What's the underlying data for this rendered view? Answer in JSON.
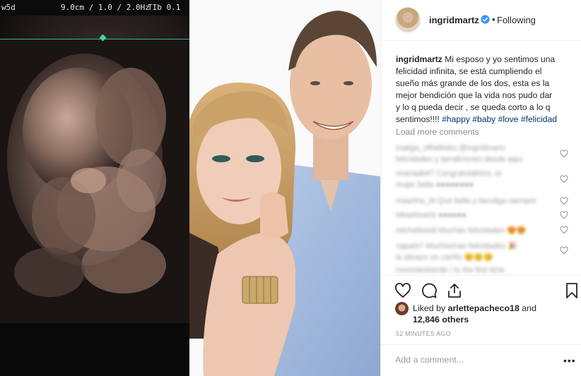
{
  "ultrasound": {
    "label_left": "w5d",
    "label_depth": "9.0cm / 1.0 / 2.0Hz",
    "label_tib": "TIb  0.1"
  },
  "header": {
    "username": "ingridmartz",
    "separator": "•",
    "follow_label": "Following"
  },
  "caption": {
    "username": "ingridmartz",
    "line1": " Mi esposo y yo sentimos una",
    "line2": "felicidad infinita, se está cumpliendo el",
    "line3": "sueño más grande de los dos, esta es la",
    "line4": "mejor bendición que la vida nos pudo dar",
    "line5": "y lo q pueda decir , se queda corto a lo q",
    "line6": "sentimos!!!! ",
    "hashtags": [
      "#happy",
      "#baby",
      "#love",
      "#felicidad"
    ]
  },
  "load_more": "Load more comments",
  "comments": [
    "matiga_ofhelitabx @ingridmartz",
    "felicidades y bendiciones desde aqui",
    "veanaab47 Congratulations, la",
    "mujer bella ●●●●●●●●",
    "maartha_9t Qué bella y bendiga siempre",
    "lekaahearts ●●●●●●",
    "michellesolt Muchas felicidades 😍😍",
    "zapat47 Muchisimas felicidades 🎉",
    "la abrazo un cariño 😊😊😊",
    "moondesherde / Is the first time"
  ],
  "likes": {
    "prefix": "Liked by ",
    "user": "arlettepacheco18",
    "and": " and",
    "count": "12,846 others"
  },
  "time_ago": "52 MINUTES AGO",
  "add_comment": {
    "placeholder": "Add a comment...",
    "more": "•••"
  },
  "colors": {
    "verified": "#3897f0",
    "hashtag": "#003569",
    "muted": "#8e8e8e",
    "ultrasound_line": "#2fb89a"
  }
}
